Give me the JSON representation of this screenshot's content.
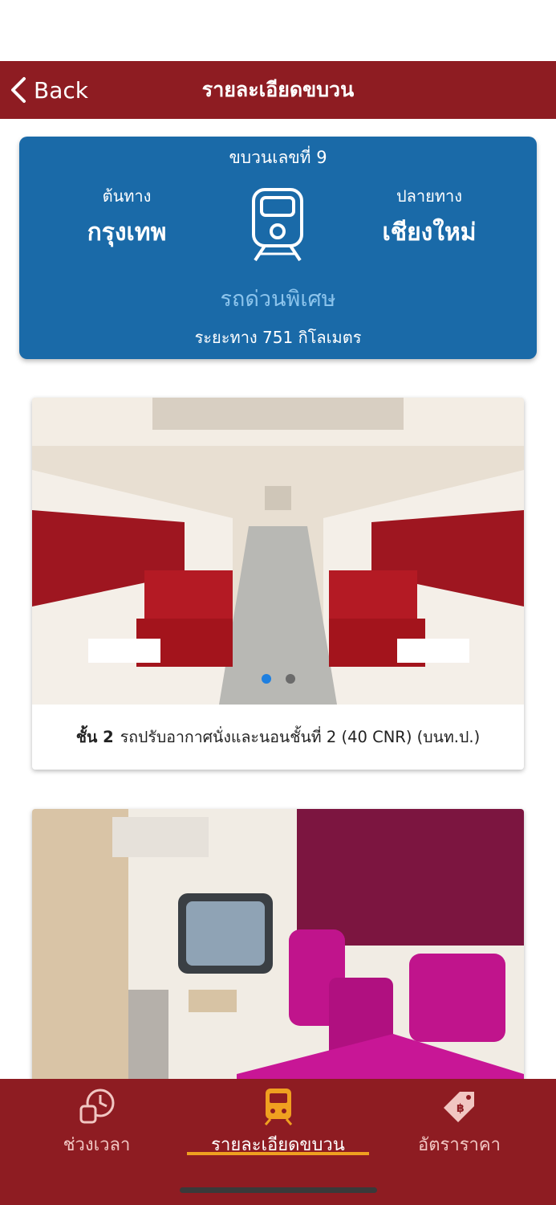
{
  "nav": {
    "back_label": "Back",
    "title": "รายละเอียดขบวน"
  },
  "train": {
    "number_label": "ขบวนเลขที่ 9",
    "origin_label": "ต้นทาง",
    "origin_city": "กรุงเทพ",
    "dest_label": "ปลายทาง",
    "dest_city": "เชียงใหม่",
    "type": "รถด่วนพิเศษ",
    "distance": "ระยะทาง 751 กิโลเมตร"
  },
  "cars": [
    {
      "class_label": "ชั้น 2",
      "description": "รถปรับอากาศนั่งและนอนชั้นที่ 2 (40 CNR) (บนท.ป.)",
      "slides": 2,
      "active_slide": 1
    }
  ],
  "tabs": [
    {
      "label": "ช่วงเวลา",
      "icon": "clock-train-icon"
    },
    {
      "label": "รายละเอียดขบวน",
      "icon": "train-icon",
      "active": true
    },
    {
      "label": "อัตราราคา",
      "icon": "price-tag-icon"
    }
  ],
  "colors": {
    "brand": "#8e1c22",
    "card": "#1a6aa8",
    "accent": "#f0a020",
    "dot_active": "#1e7fe0"
  }
}
